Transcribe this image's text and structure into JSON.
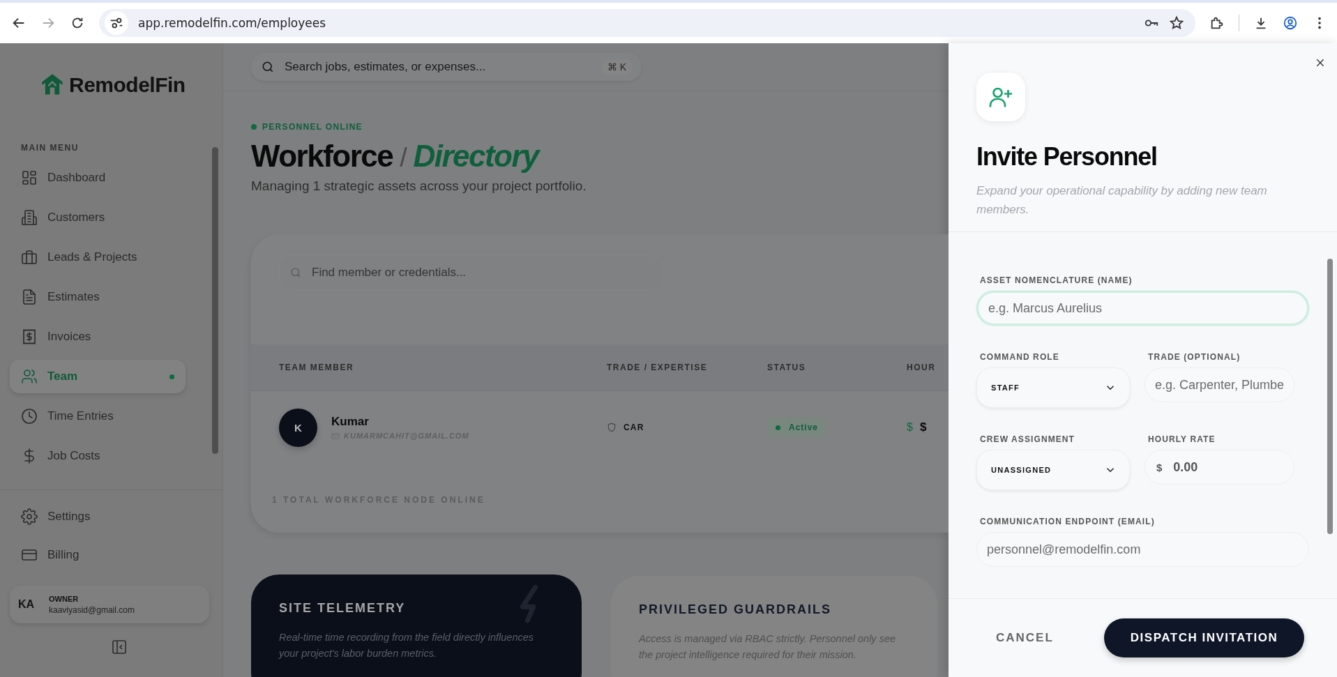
{
  "browser": {
    "url": "app.remodelfin.com/employees"
  },
  "sidebar": {
    "brand": "RemodelFin",
    "section_label": "MAIN MENU",
    "items": [
      {
        "label": "Dashboard",
        "selected": false
      },
      {
        "label": "Customers",
        "selected": false
      },
      {
        "label": "Leads & Projects",
        "selected": false
      },
      {
        "label": "Estimates",
        "selected": false
      },
      {
        "label": "Invoices",
        "selected": false
      },
      {
        "label": "Team",
        "selected": true
      },
      {
        "label": "Time Entries",
        "selected": false
      },
      {
        "label": "Job Costs",
        "selected": false
      }
    ],
    "footer_items": [
      {
        "label": "Settings"
      },
      {
        "label": "Billing"
      }
    ],
    "user": {
      "initials": "KA",
      "role": "OWNER",
      "email": "kaaviyasid@gmail.com"
    }
  },
  "topbar": {
    "search_placeholder": "Search jobs, estimates, or expenses...",
    "shortcut": "⌘ K"
  },
  "header": {
    "status": "PERSONNEL ONLINE",
    "title": "Workforce",
    "separator": "/",
    "title_accent": "Directory",
    "subtitle": "Managing 1 strategic assets across your project portfolio."
  },
  "directory": {
    "search_placeholder": "Find member or credentials...",
    "columns": [
      "TEAM MEMBER",
      "TRADE / EXPERTISE",
      "STATUS",
      "HOUR"
    ],
    "rows": [
      {
        "initials": "K",
        "name": "Kumar",
        "email": "KUMARMCAHIT@GMAIL.COM",
        "trade": "CAR",
        "status": "Active",
        "rate_symbol": "$",
        "rate": "$"
      }
    ],
    "footer": "1 TOTAL WORKFORCE NODE ONLINE"
  },
  "info_cards": [
    {
      "kind": "dark",
      "title": "SITE TELEMETRY",
      "body": "Real-time time recording from the field directly influences your project's labor burden metrics."
    },
    {
      "kind": "light",
      "title": "PRIVILEGED GUARDRAILS",
      "body": "Access is managed via RBAC strictly. Personnel only see the project intelligence required for their mission."
    }
  ],
  "drawer": {
    "title": "Invite Personnel",
    "subtitle": "Expand your operational capability by adding new team members.",
    "rows": [
      [
        {
          "kind": "text",
          "label": "ASSET NOMENCLATURE (NAME)",
          "placeholder": "e.g. Marcus Aurelius",
          "focused": true
        }
      ],
      [
        {
          "kind": "select",
          "label": "COMMAND ROLE",
          "value": "STAFF"
        },
        {
          "kind": "text",
          "label": "TRADE (OPTIONAL)",
          "placeholder": "e.g. Carpenter, Plumbe",
          "focused": false
        }
      ],
      [
        {
          "kind": "select",
          "label": "CREW ASSIGNMENT",
          "value": "UNASSIGNED"
        },
        {
          "kind": "money",
          "label": "HOURLY RATE",
          "prefix": "$",
          "placeholder": "0.00"
        }
      ],
      [
        {
          "kind": "text",
          "label": "COMMUNICATION ENDPOINT (EMAIL)",
          "placeholder": "personnel@remodelfin.com",
          "focused": false
        }
      ]
    ],
    "cancel": "CANCEL",
    "submit": "DISPATCH INVITATION"
  }
}
